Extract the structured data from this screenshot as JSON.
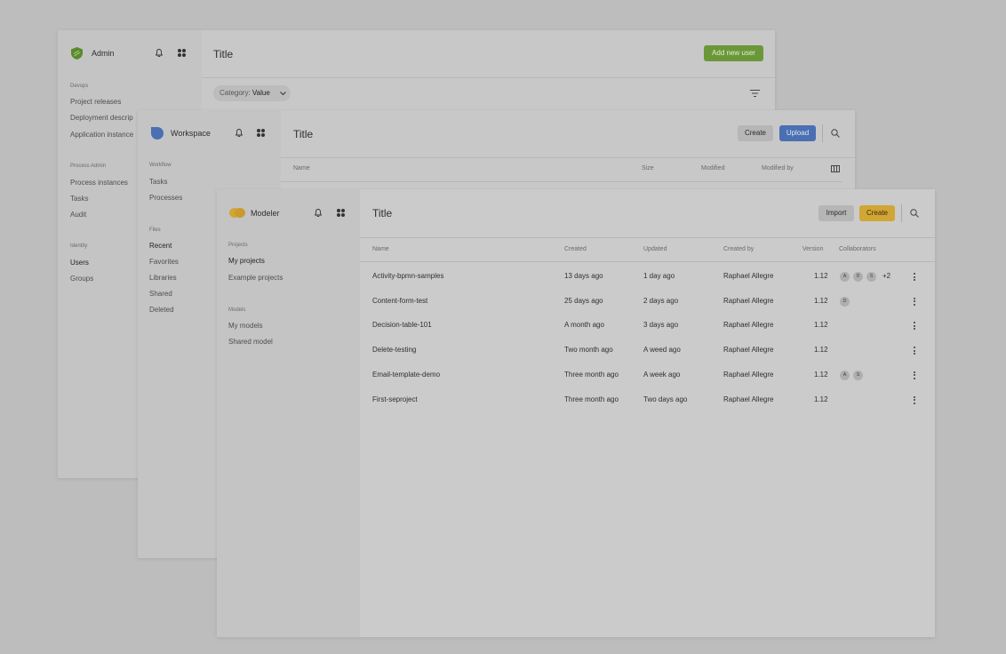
{
  "admin": {
    "app_name": "Admin",
    "title": "Title",
    "add_button": "Add new user",
    "filter": {
      "label": "Category: ",
      "value": "Value"
    },
    "sections": [
      {
        "title": "Devops",
        "items": [
          "Project releases",
          "Deployment descrip",
          "Application instance"
        ]
      },
      {
        "title": "Process Admin",
        "items": [
          "Process instances",
          "Tasks",
          "Audit"
        ]
      },
      {
        "title": "Identity",
        "items": [
          "Users",
          "Groups"
        ]
      }
    ]
  },
  "workspace": {
    "app_name": "Workspace",
    "title": "Title",
    "create_button": "Create",
    "upload_button": "Upload",
    "columns": [
      "Name",
      "Size",
      "Modified",
      "Modified by"
    ],
    "sections": [
      {
        "title": "Workflow",
        "items": [
          "Tasks",
          "Processes"
        ]
      },
      {
        "title": "Files",
        "items": [
          "Recent",
          "Favorites",
          "Libraries",
          "Shared",
          "Deleted"
        ]
      }
    ]
  },
  "modeler": {
    "app_name": "Modeler",
    "title": "Title",
    "import_button": "Import",
    "create_button": "Create",
    "sections": [
      {
        "title": "Projects",
        "items": [
          "My projects",
          "Example projects"
        ]
      },
      {
        "title": "Models",
        "items": [
          "My models",
          "Shared model"
        ]
      }
    ],
    "columns": [
      "Name",
      "Created",
      "Updated",
      "Created by",
      "Version",
      "Collaborators"
    ],
    "rows": [
      {
        "name": "Activity-bpmn-samples",
        "created": "13 days ago",
        "updated": "1 day ago",
        "created_by": "Raphael Allegre",
        "version": "1.12",
        "collaborators": [
          "A",
          "D",
          "S"
        ],
        "extra": "+2"
      },
      {
        "name": "Content-form-test",
        "created": "25 days ago",
        "updated": "2 days ago",
        "created_by": "Raphael Allegre",
        "version": "1.12",
        "collaborators": [
          "D"
        ],
        "extra": ""
      },
      {
        "name": "Decision-table-101",
        "created": "A month ago",
        "updated": "3 days ago",
        "created_by": "Raphael Allegre",
        "version": "1.12",
        "collaborators": [],
        "extra": ""
      },
      {
        "name": "Delete-testing",
        "created": "Two month ago",
        "updated": "A weed ago",
        "created_by": "Raphael Allegre",
        "version": "1.12",
        "collaborators": [],
        "extra": ""
      },
      {
        "name": "Email-template-demo",
        "created": "Three month ago",
        "updated": "A week ago",
        "created_by": "Raphael Allegre",
        "version": "1.12",
        "collaborators": [
          "A",
          "S"
        ],
        "extra": ""
      },
      {
        "name": "First-seproject",
        "created": "Three month ago",
        "updated": "Two days ago",
        "created_by": "Raphael Allegre",
        "version": "1.12",
        "collaborators": [],
        "extra": ""
      }
    ]
  },
  "colors": {
    "admin_accent": "#6a9838",
    "workspace_accent": "#4a6fb2",
    "modeler_accent": "#d1a634"
  },
  "icons": [
    "shield-icon",
    "bell-icon",
    "apps-grid-icon",
    "filter-icon",
    "chevron-down-icon",
    "search-icon",
    "columns-icon",
    "more-vertical-icon"
  ]
}
